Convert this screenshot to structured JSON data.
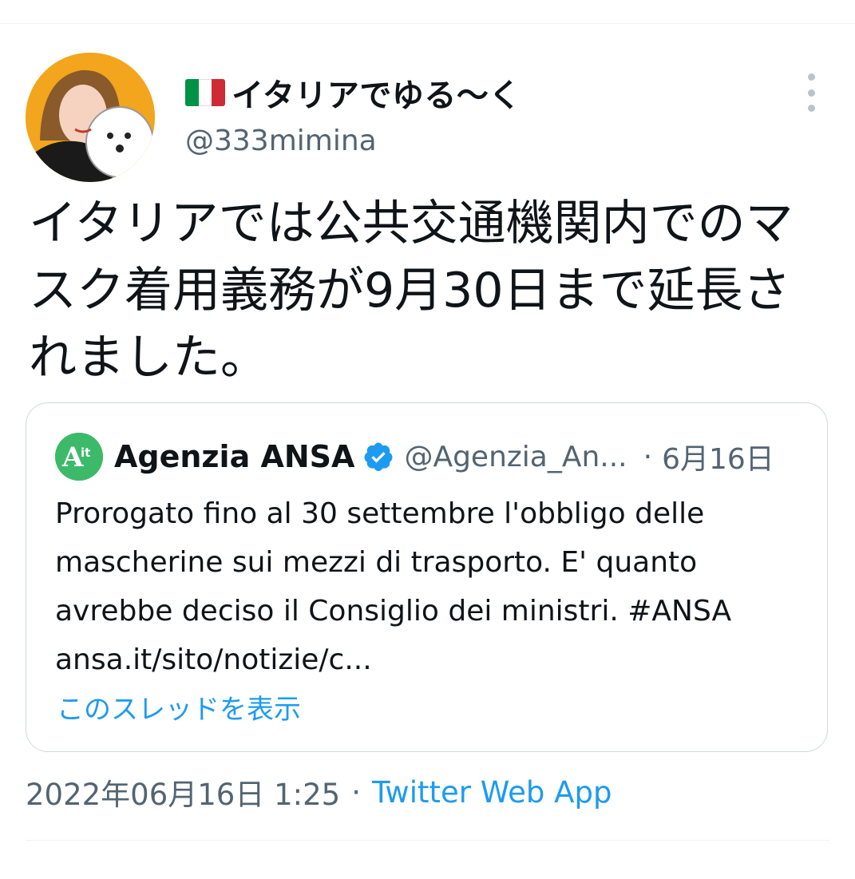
{
  "author": {
    "display_name": "イタリアでゆる〜く",
    "handle": "@333mimina"
  },
  "tweet": {
    "text": "イタリアでは公共交通機関内でのマスク着用義務が9月30日まで延長されました。"
  },
  "quote": {
    "avatar_text": "Ait",
    "name": "Agenzia ANSA",
    "handle": "@Agenzia_An...",
    "separator": "·",
    "date": "6月16日",
    "text": "Prorogato fino al 30 settembre l'obbligo delle mascherine sui mezzi di trasporto. E' quanto avrebbe deciso il Consiglio dei ministri. #ANSA ansa.it/sito/notizie/c...",
    "thread_link": "このスレッドを表示"
  },
  "meta": {
    "timestamp": "2022年06月16日 1:25",
    "separator": "·",
    "source": "Twitter Web App"
  },
  "icons": {
    "flag": "italy-flag-icon",
    "more": "more-options-icon",
    "verified": "verified-badge-icon"
  },
  "colors": {
    "accent": "#1d9bf0",
    "secondary_text": "#536471",
    "flag": [
      "#009246",
      "#ffffff",
      "#ce2b37"
    ],
    "ansa_green": "#3db96a"
  }
}
